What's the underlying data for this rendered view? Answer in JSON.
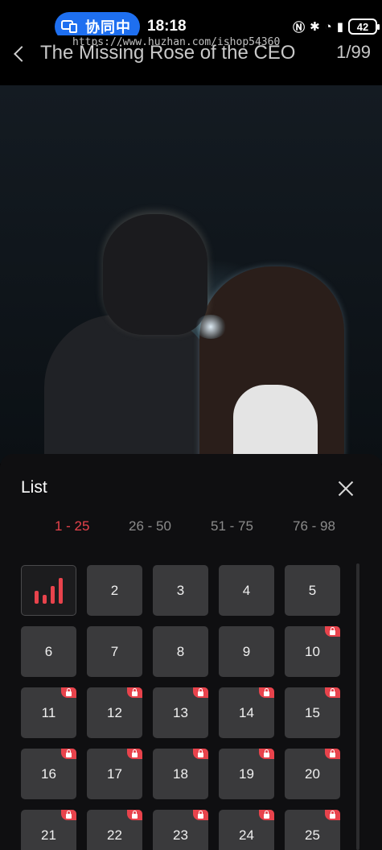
{
  "status_bar": {
    "collab_label": "协同中",
    "time": "18:18",
    "icons": [
      "nfc-icon",
      "bluetooth-icon",
      "wifi-icon",
      "sim-alert-icon"
    ],
    "battery": "42"
  },
  "header": {
    "title": "The Missing Rose of the CEO",
    "episode_position": "1/99",
    "watermark": "https://www.huzhan.com/ishop54360"
  },
  "episode_list": {
    "title": "List",
    "ranges": [
      {
        "label": "1 - 25",
        "active": true
      },
      {
        "label": "26 - 50",
        "active": false
      },
      {
        "label": "51 - 75",
        "active": false
      },
      {
        "label": "76 - 98",
        "active": false
      }
    ],
    "episodes": [
      {
        "label": "",
        "playing": true,
        "locked": false
      },
      {
        "label": "2",
        "locked": false
      },
      {
        "label": "3",
        "locked": false
      },
      {
        "label": "4",
        "locked": false
      },
      {
        "label": "5",
        "locked": false
      },
      {
        "label": "6",
        "locked": false
      },
      {
        "label": "7",
        "locked": false
      },
      {
        "label": "8",
        "locked": false
      },
      {
        "label": "9",
        "locked": false
      },
      {
        "label": "10",
        "locked": true
      },
      {
        "label": "11",
        "locked": true
      },
      {
        "label": "12",
        "locked": true
      },
      {
        "label": "13",
        "locked": true
      },
      {
        "label": "14",
        "locked": true
      },
      {
        "label": "15",
        "locked": true
      },
      {
        "label": "16",
        "locked": true
      },
      {
        "label": "17",
        "locked": true
      },
      {
        "label": "18",
        "locked": true
      },
      {
        "label": "19",
        "locked": true
      },
      {
        "label": "20",
        "locked": true
      },
      {
        "label": "21",
        "locked": true
      },
      {
        "label": "22",
        "locked": true
      },
      {
        "label": "23",
        "locked": true
      },
      {
        "label": "24",
        "locked": true
      },
      {
        "label": "25",
        "locked": true
      }
    ],
    "accent_color": "#e8434c"
  }
}
